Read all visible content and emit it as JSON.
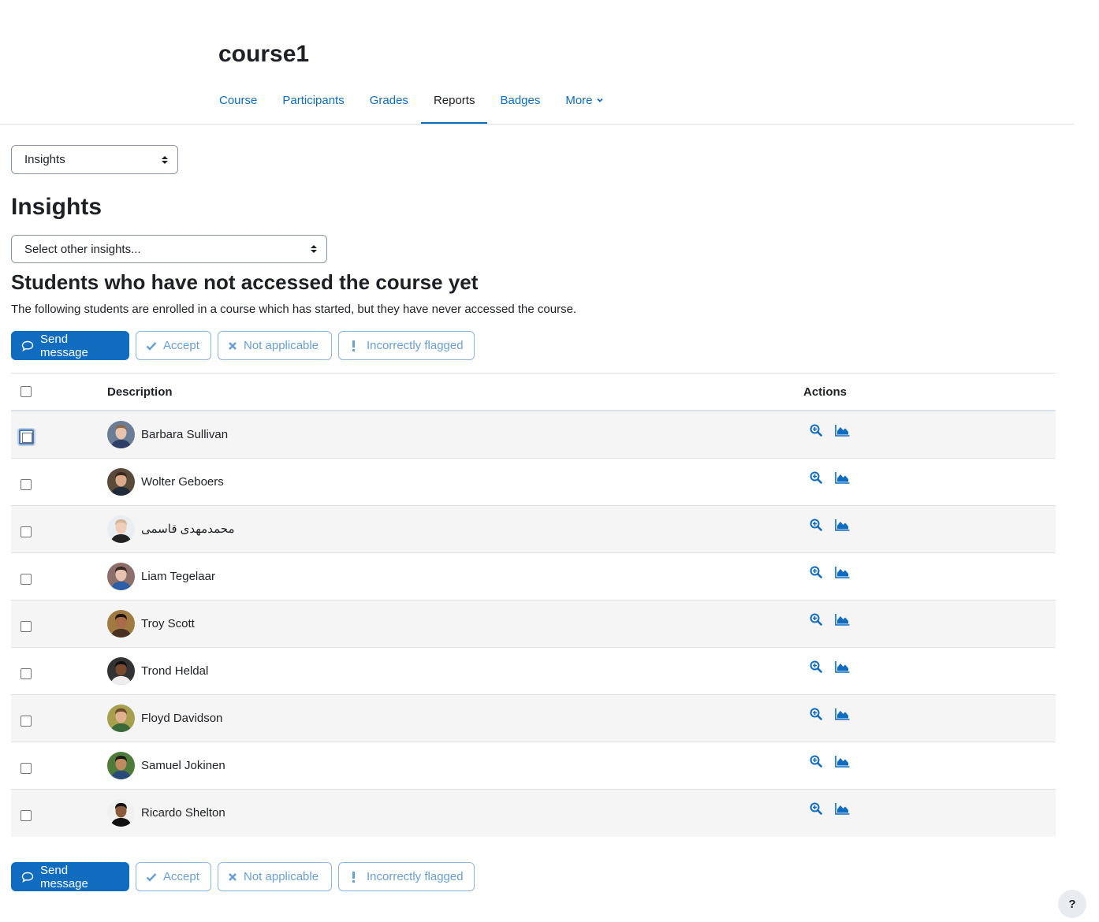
{
  "page": {
    "course_title": "course1",
    "nav_tabs": [
      {
        "label": "Course",
        "active": false
      },
      {
        "label": "Participants",
        "active": false
      },
      {
        "label": "Grades",
        "active": false
      },
      {
        "label": "Reports",
        "active": true
      },
      {
        "label": "Badges",
        "active": false
      },
      {
        "label": "More",
        "active": false
      }
    ]
  },
  "report_selector": {
    "value": "Insights"
  },
  "insights": {
    "heading": "Insights",
    "other_selector_placeholder": "Select other insights...",
    "model_heading": "Students who have not accessed the course yet",
    "description": "The following students are enrolled in a course which has started, but they have never accessed the course."
  },
  "actions": {
    "send_message": "Send message",
    "accept": "Accept",
    "not_applicable": "Not applicable",
    "incorrectly_flagged": "Incorrectly flagged"
  },
  "table": {
    "col_description": "Description",
    "col_actions": "Actions",
    "rows": [
      {
        "name": "Barbara Sullivan",
        "avatar": {
          "bg": "#6a7d96",
          "skin": "#e8c4ae",
          "hair": "#8a6a55",
          "shirt": "#2f3e66"
        }
      },
      {
        "name": "Wolter Geboers",
        "avatar": {
          "bg": "#5a4a3a",
          "skin": "#d9a98c",
          "hair": "#3b2a20",
          "shirt": "#1f2a3a"
        }
      },
      {
        "name": "محمدمهدی قاسمی",
        "avatar": {
          "bg": "#e9eef0",
          "skin": "#f0cdb8",
          "hair": "#d4b79a",
          "shirt": "#222222"
        }
      },
      {
        "name": "Liam Tegelaar",
        "avatar": {
          "bg": "#8c6f6a",
          "skin": "#e6c2b0",
          "hair": "#3a2620",
          "shirt": "#2d5fa8"
        }
      },
      {
        "name": "Troy Scott",
        "avatar": {
          "bg": "#a07a40",
          "skin": "#a86c4a",
          "hair": "#1e120c",
          "shirt": "#4a3020"
        }
      },
      {
        "name": "Trond Heldal",
        "avatar": {
          "bg": "#333333",
          "skin": "#7a4a30",
          "hair": "#111111",
          "shirt": "#eeeeee"
        }
      },
      {
        "name": "Floyd Davidson",
        "avatar": {
          "bg": "#a6a04e",
          "skin": "#e0b090",
          "hair": "#6a4a2a",
          "shirt": "#3a6a3a"
        }
      },
      {
        "name": "Samuel Jokinen",
        "avatar": {
          "bg": "#4e7a3a",
          "skin": "#c08a60",
          "hair": "#1a1a1a",
          "shirt": "#2a4a7a"
        }
      },
      {
        "name": "Ricardo Shelton",
        "avatar": {
          "bg": "#f0f0f0",
          "skin": "#8a5a3a",
          "hair": "#111111",
          "shirt": "#111111"
        }
      }
    ]
  },
  "help": {
    "label": "?"
  },
  "colors": {
    "primary": "#0f6cbf",
    "text": "#1d2125",
    "row_alt": "#f5f5f5"
  }
}
